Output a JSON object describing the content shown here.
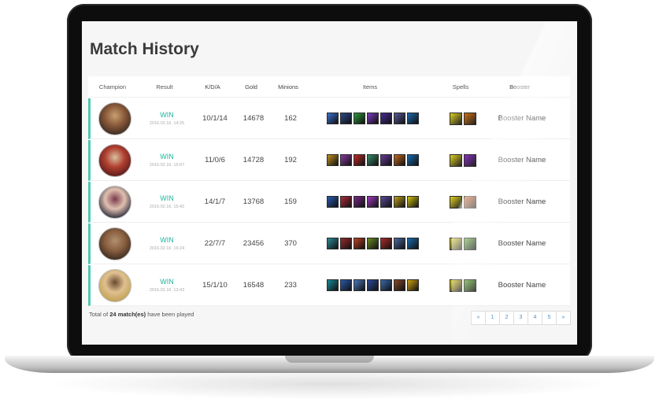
{
  "title": "Match History",
  "headers": [
    "Champion",
    "Result",
    "K/D/A",
    "Gold",
    "Minions",
    "Items",
    "Spells",
    "Booster"
  ],
  "rows": [
    {
      "result": "WIN",
      "date": "2016.02.16. 14:25",
      "kda": "10/1/14",
      "gold": "14678",
      "minions": "162",
      "booster": "Booster Name",
      "avatar": [
        "#3a2a22",
        "#8a5a3a",
        "#c9a070"
      ],
      "items": [
        "#3b6fd0",
        "#2a4a8a",
        "#2f9a3a",
        "#7a3ac0",
        "#4a2a9a",
        "#5a5a9a",
        "#1a6ab0"
      ],
      "spells": [
        "#e0d020",
        "#d07010"
      ]
    },
    {
      "result": "WIN",
      "date": "2016.02.16. 15:07",
      "kda": "11/0/6",
      "gold": "14728",
      "minions": "192",
      "booster": "Booster Name",
      "avatar": [
        "#5a1a1a",
        "#b04030",
        "#d8c0a0"
      ],
      "items": [
        "#c09020",
        "#8a3aa0",
        "#c02a2a",
        "#3a8a6a",
        "#6a3a9a",
        "#c06a20",
        "#1a6ab0"
      ],
      "spells": [
        "#e0d020",
        "#8a30c0"
      ]
    },
    {
      "result": "WIN",
      "date": "2016.02.16. 15:42",
      "kda": "14/1/7",
      "gold": "13768",
      "minions": "159",
      "booster": "Booster Name",
      "avatar": [
        "#2a2a3a",
        "#e0c0b0",
        "#7a3a4a"
      ],
      "items": [
        "#2a5ab0",
        "#b02a3a",
        "#7a2a8a",
        "#a03ac0",
        "#5a4a9a",
        "#c0a020",
        "#d0c010"
      ],
      "spells": [
        "#e0d020",
        "#d05010"
      ]
    },
    {
      "result": "WIN",
      "date": "2016.02.16. 16:24",
      "kda": "22/7/7",
      "gold": "23456",
      "minions": "370",
      "booster": "Booster Name",
      "avatar": [
        "#3a2a20",
        "#8a6040",
        "#b09070"
      ],
      "items": [
        "#2a8a9a",
        "#9a2a2a",
        "#c04020",
        "#6a8a20",
        "#b02a2a",
        "#4a6aa0",
        "#1a6ab0"
      ],
      "spells": [
        "#e0d020",
        "#6ab040"
      ]
    },
    {
      "result": "WIN",
      "date": "2016.02.16. 13:43",
      "kda": "15/1/10",
      "gold": "16548",
      "minions": "233",
      "booster": "Booster Name",
      "avatar": [
        "#c0a050",
        "#e0c090",
        "#6a4a30"
      ],
      "items": [
        "#1a8a9a",
        "#2a5ab0",
        "#4a7ac0",
        "#2a4a9a",
        "#3a6ab0",
        "#8a4a2a",
        "#d0a010"
      ],
      "spells": [
        "#e0d020",
        "#6ab040"
      ]
    }
  ],
  "footer": {
    "prefix": "Total of ",
    "count": "24 match(es)",
    "suffix": " have been played"
  },
  "pagination": [
    "«",
    "1",
    "2",
    "3",
    "4",
    "5",
    "»"
  ]
}
